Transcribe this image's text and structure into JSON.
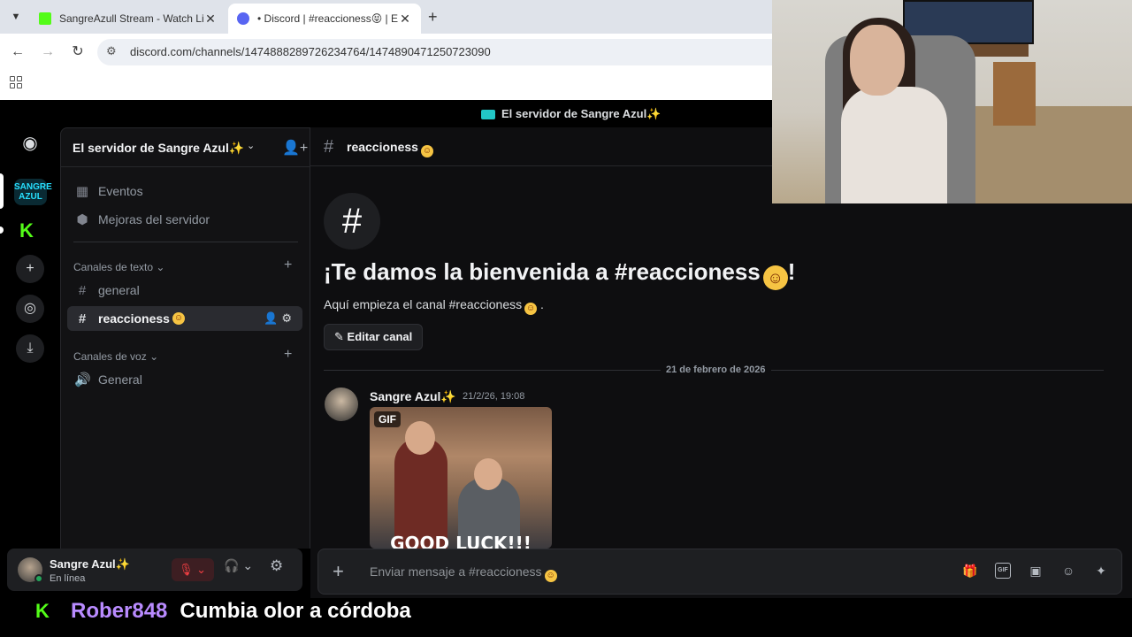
{
  "browser": {
    "tabs": [
      {
        "title": "SangreAzull Stream - Watch Liv",
        "active": false
      },
      {
        "title": "• Discord | #reaccioness😝 | El",
        "active": true
      }
    ],
    "url": "discord.com/channels/1474888289726234764/1474890471250723090"
  },
  "discord": {
    "top_server_label": "El servidor de Sangre Azul✨",
    "server_rail": {
      "server_sa_text": "SANGRE AZUL",
      "server_k_text": "K"
    },
    "sidebar": {
      "server_name": "El servidor de Sangre Azul✨",
      "items": [
        {
          "label": "Eventos"
        },
        {
          "label": "Mejoras del servidor"
        }
      ],
      "text_category": "Canales de texto",
      "text_channels": [
        {
          "label": "general"
        },
        {
          "label": "reaccioness"
        }
      ],
      "voice_category": "Canales de voz",
      "voice_channels": [
        {
          "label": "General"
        }
      ]
    },
    "user_panel": {
      "name": "Sangre Azul✨",
      "status": "En línea"
    },
    "channel": {
      "name": "reaccioness",
      "welcome_title": "¡Te damos la bienvenida a #reaccioness",
      "welcome_title_end": "!",
      "welcome_sub": "Aquí empieza el canal #reaccioness",
      "welcome_sub_end": ".",
      "edit_button": "Editar canal",
      "date_divider": "21 de febrero de 2026",
      "message": {
        "author": "Sangre Azul✨",
        "time": "21/2/26, 19:08",
        "gif_badge": "GIF",
        "gif_caption": "GOOD LUCK!!!"
      },
      "composer_placeholder": "Enviar mensaje a #reaccioness"
    }
  },
  "stream_chat": {
    "user": "Rober848",
    "text": "Cumbia olor a córdoba"
  },
  "colors": {
    "discord_bg": "#0e0e10",
    "kick_green": "#53fc18",
    "chat_user": "#b98bff",
    "online": "#23a55a"
  }
}
